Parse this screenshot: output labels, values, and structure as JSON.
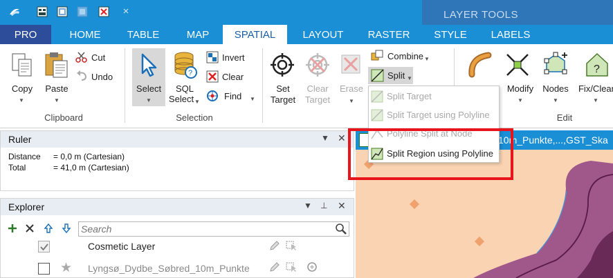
{
  "quick_access": {
    "icons": [
      "app-menu-icon",
      "new-workspace-icon",
      "open-workspace-icon",
      "close-workspace-icon",
      "save-icon",
      "customize-chevron-icon"
    ]
  },
  "contextual_header": {
    "label": "LAYER TOOLS"
  },
  "tabs": [
    "PRO",
    "HOME",
    "TABLE",
    "MAP",
    "SPATIAL",
    "LAYOUT",
    "RASTER",
    "STYLE",
    "LABELS"
  ],
  "active_tab": "SPATIAL",
  "ribbon": {
    "clipboard": {
      "copy": "Copy",
      "paste": "Paste",
      "cut": "Cut",
      "undo": "Undo",
      "group": "Clipboard"
    },
    "selection": {
      "select": "Select",
      "sql_select_line1": "SQL",
      "sql_select_line2": "Select",
      "invert": "Invert",
      "clear": "Clear",
      "find": "Find",
      "group": "Selection"
    },
    "target": {
      "set_line1": "Set",
      "set_line2": "Target",
      "clear_line1": "Clear",
      "clear_line2": "Target",
      "erase": "Erase"
    },
    "split_group": {
      "combine": "Combine",
      "split": "Split"
    },
    "edit": {
      "modify": "Modify",
      "nodes": "Nodes",
      "fix_clear": "Fix/Clear",
      "group": "Edit"
    }
  },
  "split_menu": {
    "items": [
      {
        "label": "Split Target",
        "enabled": false
      },
      {
        "label": "Split Target using Polyline",
        "enabled": false
      },
      {
        "label": "Polyline Split at Node",
        "enabled": false
      },
      {
        "label": "Split Region using Polyline",
        "enabled": true
      }
    ]
  },
  "ruler": {
    "title": "Ruler",
    "distance_label": "Distance",
    "distance_value": "= 0,0 m (Cartesian)",
    "total_label": "Total",
    "total_value": "= 41,0 m (Cartesian)"
  },
  "explorer": {
    "title": "Explorer",
    "search_placeholder": "Search",
    "layers": [
      {
        "name": "Cosmetic Layer",
        "checked": true
      },
      {
        "name": "Lyngsø_Dydbe_Søbred_10m_Punkte",
        "checked": false
      }
    ]
  },
  "map": {
    "title": "10m_Punkte,...,GST_Ska"
  },
  "colors": {
    "accent": "#1a8fd6",
    "pro_tab": "#2d4d9a",
    "layer_tools": "#2f76b8",
    "map_fill": "#f9d3b2",
    "region": "#a0588a",
    "highlight": "#e8141c"
  }
}
